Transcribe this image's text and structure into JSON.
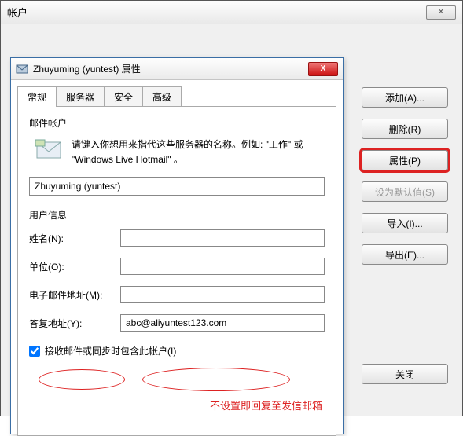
{
  "outer": {
    "title": "帐户",
    "close_glyph": "✕",
    "buttons": {
      "add": "添加(A)...",
      "delete": "删除(R)",
      "properties": "属性(P)",
      "set_default": "设为默认值(S)",
      "import": "导入(I)...",
      "export": "导出(E)...",
      "close": "关闭"
    }
  },
  "inner": {
    "title": "Zhuyuming (yuntest) 属性",
    "close_glyph": "X",
    "tabs": {
      "general": "常规",
      "server": "服务器",
      "security": "安全",
      "advanced": "高级"
    },
    "mail_account": {
      "group": "邮件帐户",
      "hint": "请键入你想用来指代这些服务器的名称。例如: \"工作\" 或 \"Windows Live Hotmail\" 。",
      "value": "Zhuyuming (yuntest)"
    },
    "user_info": {
      "group": "用户信息",
      "name_label": "姓名(N):",
      "name_value": "",
      "org_label": "单位(O):",
      "org_value": "",
      "email_label": "电子邮件地址(M):",
      "email_value": "",
      "reply_label": "答复地址(Y):",
      "reply_value": "abc@aliyuntest123.com"
    },
    "include_checkbox": {
      "label": "接收邮件或同步时包含此帐户(I)",
      "checked": true
    }
  },
  "annotation": "不设置即回复至发信邮箱"
}
